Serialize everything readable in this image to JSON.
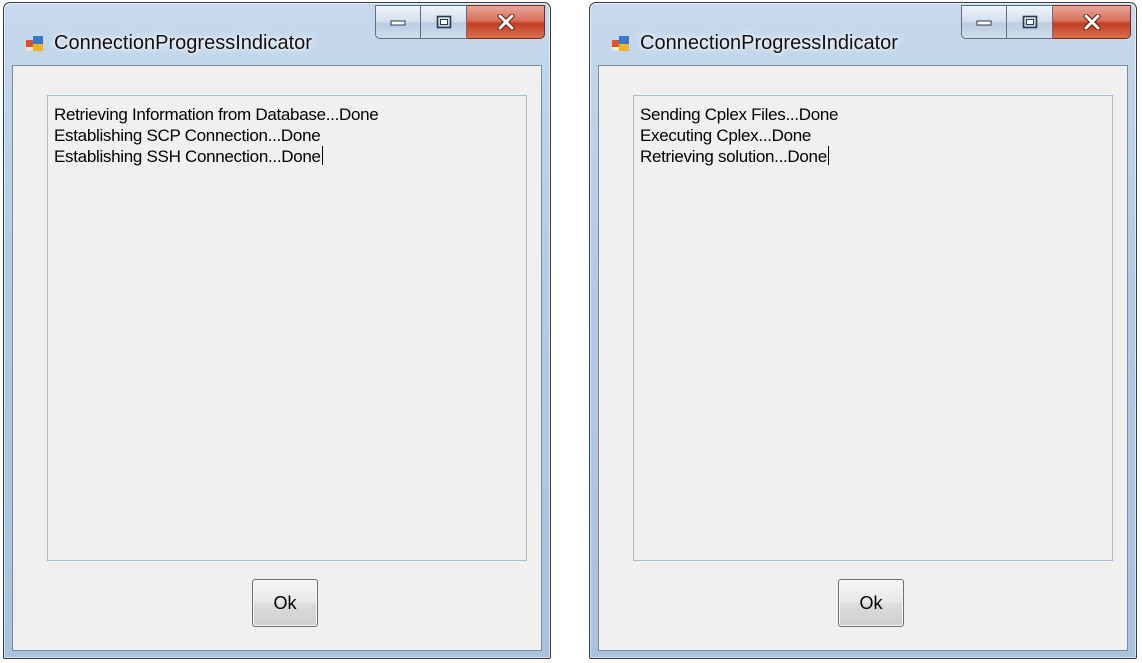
{
  "windows": [
    {
      "title": "ConnectionProgressIndicator",
      "lines": [
        "Retrieving Information from Database...Done",
        "Establishing SCP Connection...Done",
        "Establishing SSH Connection...Done"
      ],
      "ok_label": "Ok"
    },
    {
      "title": "ConnectionProgressIndicator",
      "lines": [
        "Sending Cplex Files...Done",
        "Executing Cplex...Done",
        "Retrieving solution...Done"
      ],
      "ok_label": "Ok"
    }
  ],
  "icons": {
    "app": "app-form-icon",
    "minimize": "minimize-icon",
    "maximize": "maximize-icon",
    "close": "close-icon"
  }
}
